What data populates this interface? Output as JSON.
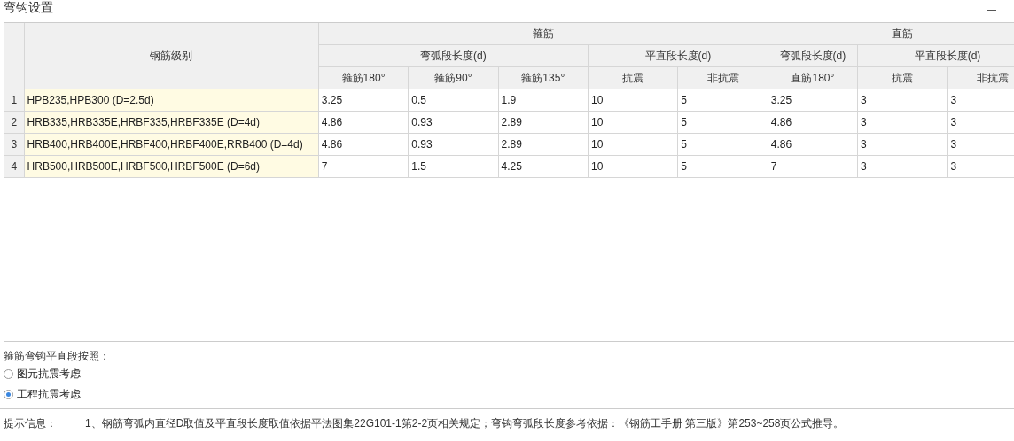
{
  "window": {
    "title": "弯钩设置"
  },
  "table": {
    "grade_header": "钢筋级别",
    "groups": [
      {
        "label": "箍筋",
        "subgroups": [
          {
            "label": "弯弧段长度(d)",
            "columns": [
              "箍筋180°",
              "箍筋90°",
              "箍筋135°"
            ]
          },
          {
            "label": "平直段长度(d)",
            "columns": [
              "抗震",
              "非抗震"
            ]
          }
        ]
      },
      {
        "label": "直筋",
        "subgroups": [
          {
            "label": "弯弧段长度(d)",
            "columns": [
              "直筋180°"
            ]
          },
          {
            "label": "平直段长度(d)",
            "columns": [
              "抗震",
              "非抗震"
            ]
          }
        ]
      }
    ],
    "rows": [
      {
        "index": "1",
        "grade": "HPB235,HPB300 (D=2.5d)",
        "values": [
          "3.25",
          "0.5",
          "1.9",
          "10",
          "5",
          "3.25",
          "3",
          "3"
        ]
      },
      {
        "index": "2",
        "grade": "HRB335,HRB335E,HRBF335,HRBF335E (D=4d)",
        "values": [
          "4.86",
          "0.93",
          "2.89",
          "10",
          "5",
          "4.86",
          "3",
          "3"
        ]
      },
      {
        "index": "3",
        "grade": "HRB400,HRB400E,HRBF400,HRBF400E,RRB400 (D=4d)",
        "values": [
          "4.86",
          "0.93",
          "2.89",
          "10",
          "5",
          "4.86",
          "3",
          "3"
        ]
      },
      {
        "index": "4",
        "grade": "HRB500,HRB500E,HRBF500,HRBF500E (D=6d)",
        "values": [
          "7",
          "1.5",
          "4.25",
          "10",
          "5",
          "7",
          "3",
          "3"
        ]
      }
    ]
  },
  "option_label": "箍筋弯钩平直段按照：",
  "options": [
    {
      "label": "图元抗震考虑",
      "selected": false
    },
    {
      "label": "工程抗震考虑",
      "selected": true
    }
  ],
  "hint": {
    "label": "提示信息：",
    "text": "1、钢筋弯弧内直径D取值及平直段长度取值依据平法图集22G101-1第2-2页相关规定；弯钩弯弧段长度参考依据：《钢筋工手册 第三版》第253~258页公式推导。"
  }
}
